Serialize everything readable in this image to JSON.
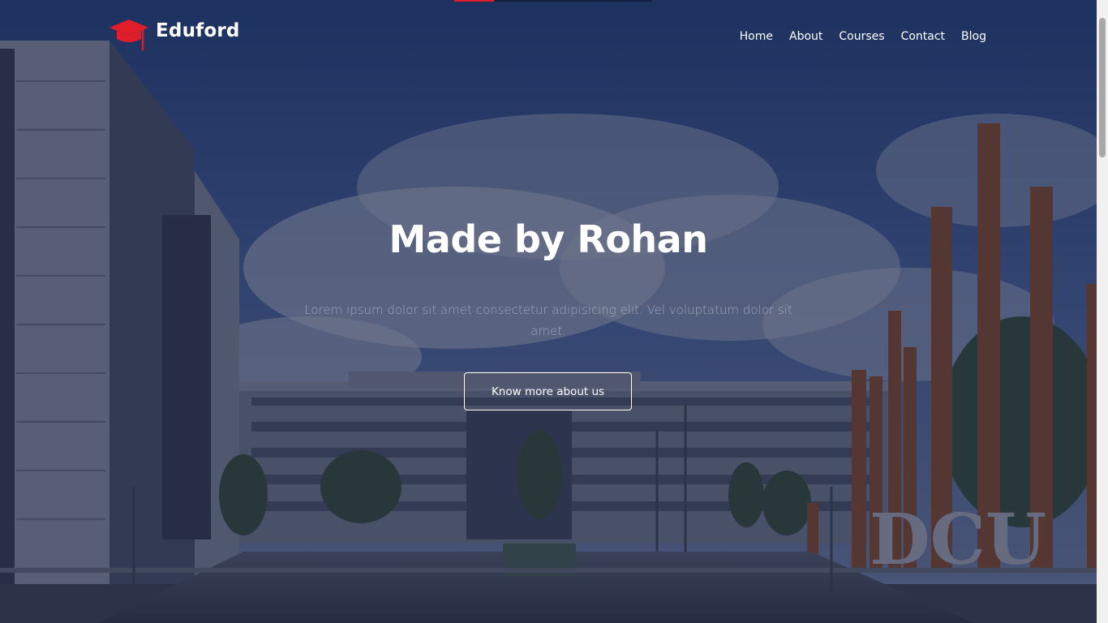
{
  "brand": {
    "name": "Eduford",
    "icon": "graduation-cap-icon",
    "color": "#e11d2a"
  },
  "nav": {
    "items": [
      {
        "label": "Home"
      },
      {
        "label": "About"
      },
      {
        "label": "Courses"
      },
      {
        "label": "Contact"
      },
      {
        "label": "Blog"
      }
    ]
  },
  "hero": {
    "title": "Made by Rohan",
    "subtitle": "Lorem ipsum dolor sit amet consectetur adipisicing elit. Vel voluptatum dolor sit amet.",
    "button_label": "Know more about us",
    "background": "DCU campus photo"
  },
  "top_progress": {
    "color": "#e11d2a",
    "fraction": 0.2
  },
  "colors": {
    "overlay": "#141c3a",
    "text": "#ffffff",
    "accent": "#e11d2a"
  }
}
